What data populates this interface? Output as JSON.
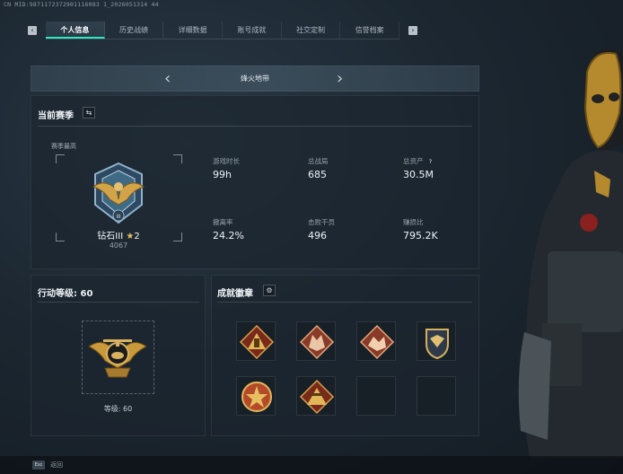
{
  "id_line": "CN MID:9871172372901116083 1_2026051314 44",
  "tabs": [
    {
      "label": "个人信息",
      "active": true
    },
    {
      "label": "历史战绩",
      "active": false
    },
    {
      "label": "详细数据",
      "active": false
    },
    {
      "label": "账号成就",
      "active": false
    },
    {
      "label": "社交定制",
      "active": false
    },
    {
      "label": "信誉档案",
      "active": false
    }
  ],
  "mode_selector": {
    "title": "烽火地带"
  },
  "season_panel": {
    "title": "当前赛季",
    "season_best_label": "赛季最高",
    "rank_name": "钻石III",
    "rank_stars": "2",
    "rank_score": "4067",
    "stats": [
      {
        "label": "游戏时长",
        "value": "99h"
      },
      {
        "label": "总战局",
        "value": "685"
      },
      {
        "label": "总资产",
        "value": "30.5M",
        "help": "?"
      },
      {
        "label": "撤离率",
        "value": "24.2%"
      },
      {
        "label": "击败干员",
        "value": "496"
      },
      {
        "label": "赚损比",
        "value": "795.2K"
      }
    ]
  },
  "level_panel": {
    "title": "行动等级: 60",
    "level_label": "等级: 60"
  },
  "achievement_panel": {
    "title": "成就徽章"
  },
  "bottom_bar": {
    "key": "Esc",
    "label": "返回"
  },
  "colors": {
    "accent": "#2ee8c2",
    "gold": "#c99a3c",
    "panel_bg": "#1c262f"
  }
}
